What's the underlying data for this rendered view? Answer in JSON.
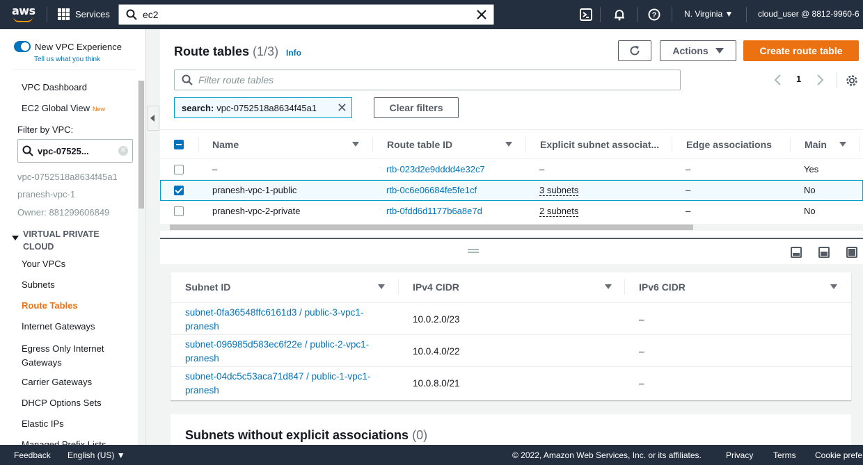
{
  "topbar": {
    "logo": "aws",
    "services_label": "Services",
    "search_value": "ec2",
    "region": "N. Virginia ▼",
    "user": "cloud_user @ 8812-9960-6"
  },
  "sidebar": {
    "toggle_label": "New VPC Experience",
    "tell_us": "Tell us what you think",
    "dashboard": "VPC Dashboard",
    "global_view": "EC2 Global View",
    "new_badge": "New",
    "filter_label": "Filter by VPC:",
    "vpc_filter_value": "vpc-07525...",
    "vpc_id": "vpc-0752518a8634f45a1",
    "vpc_name": "pranesh-vpc-1",
    "owner": "Owner: 881299606849",
    "section_title": "VIRTUAL PRIVATE CLOUD",
    "items": [
      "Your VPCs",
      "Subnets",
      "Route Tables",
      "Internet Gateways",
      "Egress Only Internet Gateways",
      "Carrier Gateways",
      "DHCP Options Sets",
      "Elastic IPs",
      "Managed Prefix Lists"
    ]
  },
  "main": {
    "title": "Route tables",
    "count": "(1/3)",
    "info": "Info",
    "actions_label": "Actions",
    "create_label": "Create route table",
    "filter_placeholder": "Filter route tables",
    "page_number": "1",
    "token_key": "search:",
    "token_value": "vpc-0752518a8634f45a1",
    "clear_filters": "Clear filters",
    "columns": [
      "Name",
      "Route table ID",
      "Explicit subnet associat...",
      "Edge associations",
      "Main"
    ],
    "rows": [
      {
        "name": "–",
        "id": "rtb-023d2e9dddd4e32c7",
        "explicit": "–",
        "edge": "–",
        "main": "Yes",
        "selected": false
      },
      {
        "name": "pranesh-vpc-1-public",
        "id": "rtb-0c6e06684fe5fe1cf",
        "explicit": "3 subnets",
        "edge": "–",
        "main": "No",
        "selected": true
      },
      {
        "name": "pranesh-vpc-2-private",
        "id": "rtb-0fdd6d1177b6a8e7d",
        "explicit": "2 subnets",
        "edge": "–",
        "main": "No",
        "selected": false
      }
    ]
  },
  "subnets_panel": {
    "columns": [
      "Subnet ID",
      "IPv4 CIDR",
      "IPv6 CIDR"
    ],
    "rows": [
      {
        "subnet": "subnet-0fa36548ffc6161d3 / public-3-vpc1-pranesh",
        "ipv4": "10.0.2.0/23",
        "ipv6": "–"
      },
      {
        "subnet": "subnet-096985d583ec6f22e / public-2-vpc1-pranesh",
        "ipv4": "10.0.4.0/22",
        "ipv6": "–"
      },
      {
        "subnet": "subnet-04dc5c53aca71d847 / public-1-vpc1-pranesh",
        "ipv4": "10.0.8.0/21",
        "ipv6": "–"
      }
    ],
    "without_title": "Subnets without explicit associations",
    "without_count": "(0)"
  },
  "footer": {
    "feedback": "Feedback",
    "language": "English (US) ▼",
    "copyright": "© 2022, Amazon Web Services, Inc. or its affiliates.",
    "privacy": "Privacy",
    "terms": "Terms",
    "cookie": "Cookie prefe"
  }
}
